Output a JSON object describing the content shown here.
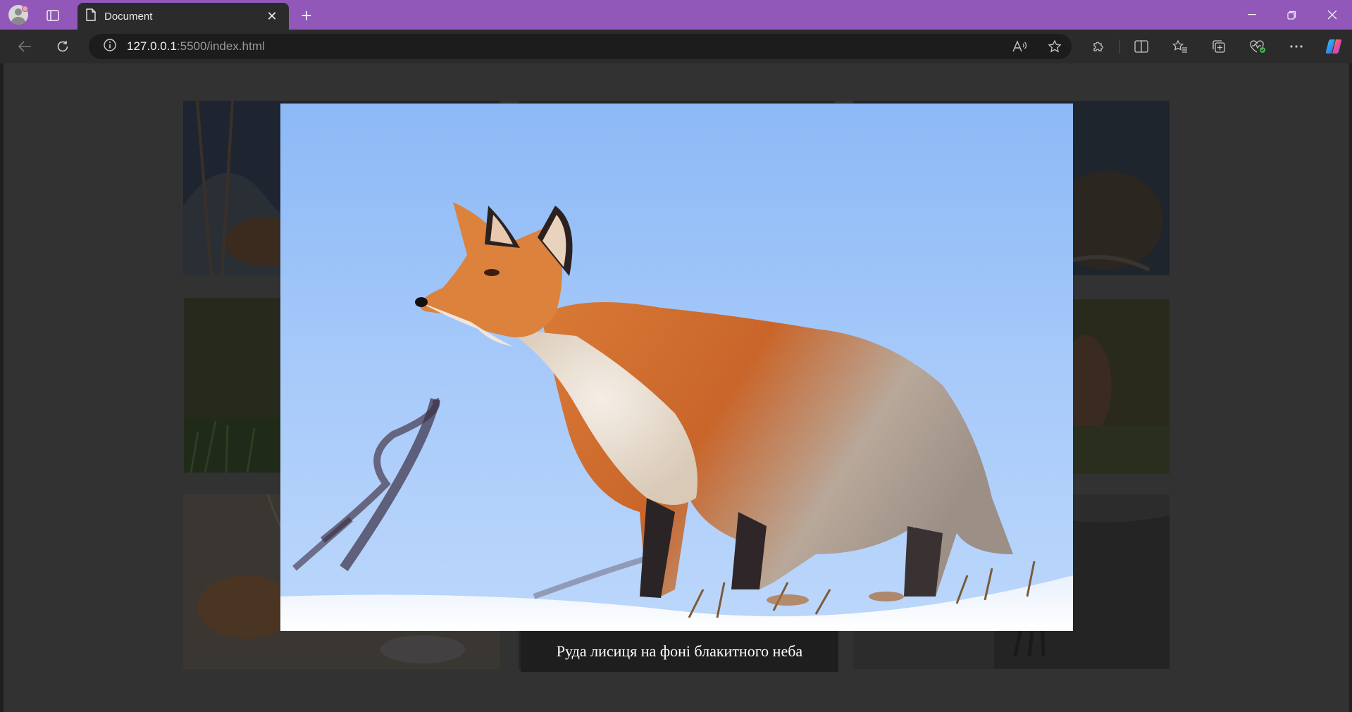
{
  "browser": {
    "tab_title": "Document",
    "url_host": "127.0.0.1",
    "url_rest": ":5500/index.html",
    "accent_color": "#9157b9"
  },
  "icons": {
    "profile": "profile-avatar-icon",
    "tabs": "vertical-tabs-icon",
    "page": "document-icon",
    "close": "close-icon",
    "new_tab": "plus-icon",
    "back": "back-arrow-icon",
    "refresh": "refresh-icon",
    "info": "info-icon",
    "read_aloud": "read-aloud-icon",
    "favorite": "star-icon",
    "extensions": "puzzle-icon",
    "split": "split-screen-icon",
    "favorites": "favorites-icon",
    "collections": "collections-icon",
    "health": "browser-essentials-icon",
    "more": "more-icon",
    "copilot": "copilot-icon"
  },
  "gallery": {
    "overlay_color": "#323232",
    "open_image": {
      "caption": "Руда лисиця на фоні блакитного неба"
    }
  }
}
